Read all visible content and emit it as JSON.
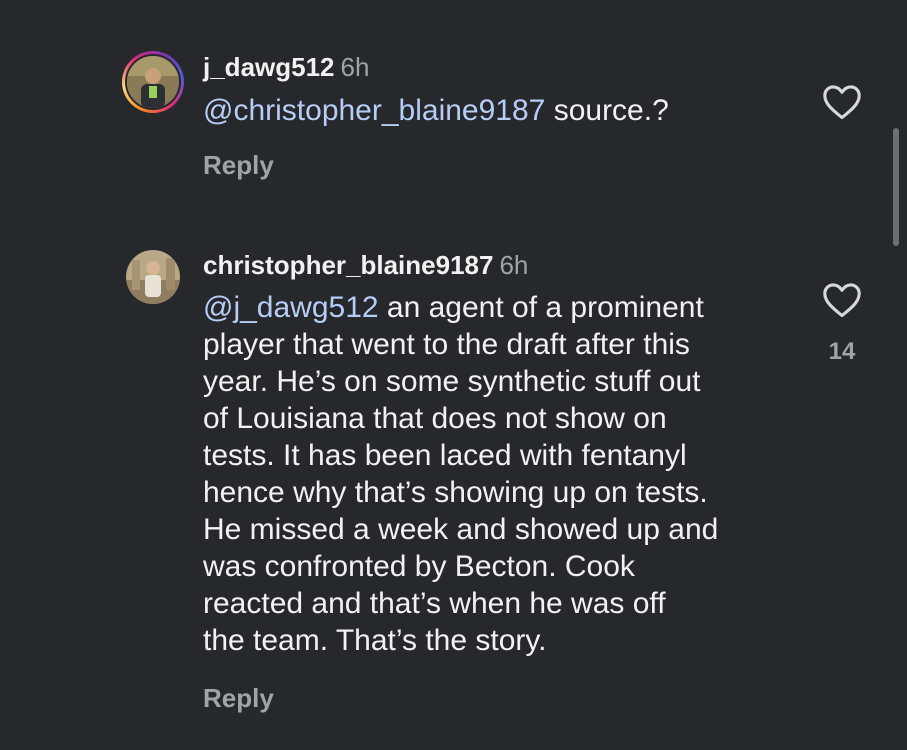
{
  "comments": [
    {
      "username": "j_dawg512",
      "time": "6h",
      "mention": "@christopher_blaine9187",
      "text": " source.?",
      "reply_label": "Reply",
      "likes": ""
    },
    {
      "username": "christopher_blaine9187",
      "time": "6h",
      "mention": "@j_dawg512",
      "lines": [
        " an agent of a prominent",
        "player that went to the draft after this",
        "year. He’s on some synthetic stuff out",
        "of Louisiana that does not show on",
        "tests. It has been laced with fentanyl",
        "hence why that’s showing up on tests.",
        "He missed a week and showed up and",
        "was confronted by Becton. Cook",
        "reacted and that’s when he was off",
        "the team. That’s the story."
      ],
      "reply_label": "Reply",
      "likes": "14"
    }
  ],
  "icons": {
    "like": "heart-outline-icon"
  },
  "colors": {
    "background": "#26282c",
    "mention": "#b6cdf6",
    "secondary_text": "#a0a3a8"
  }
}
